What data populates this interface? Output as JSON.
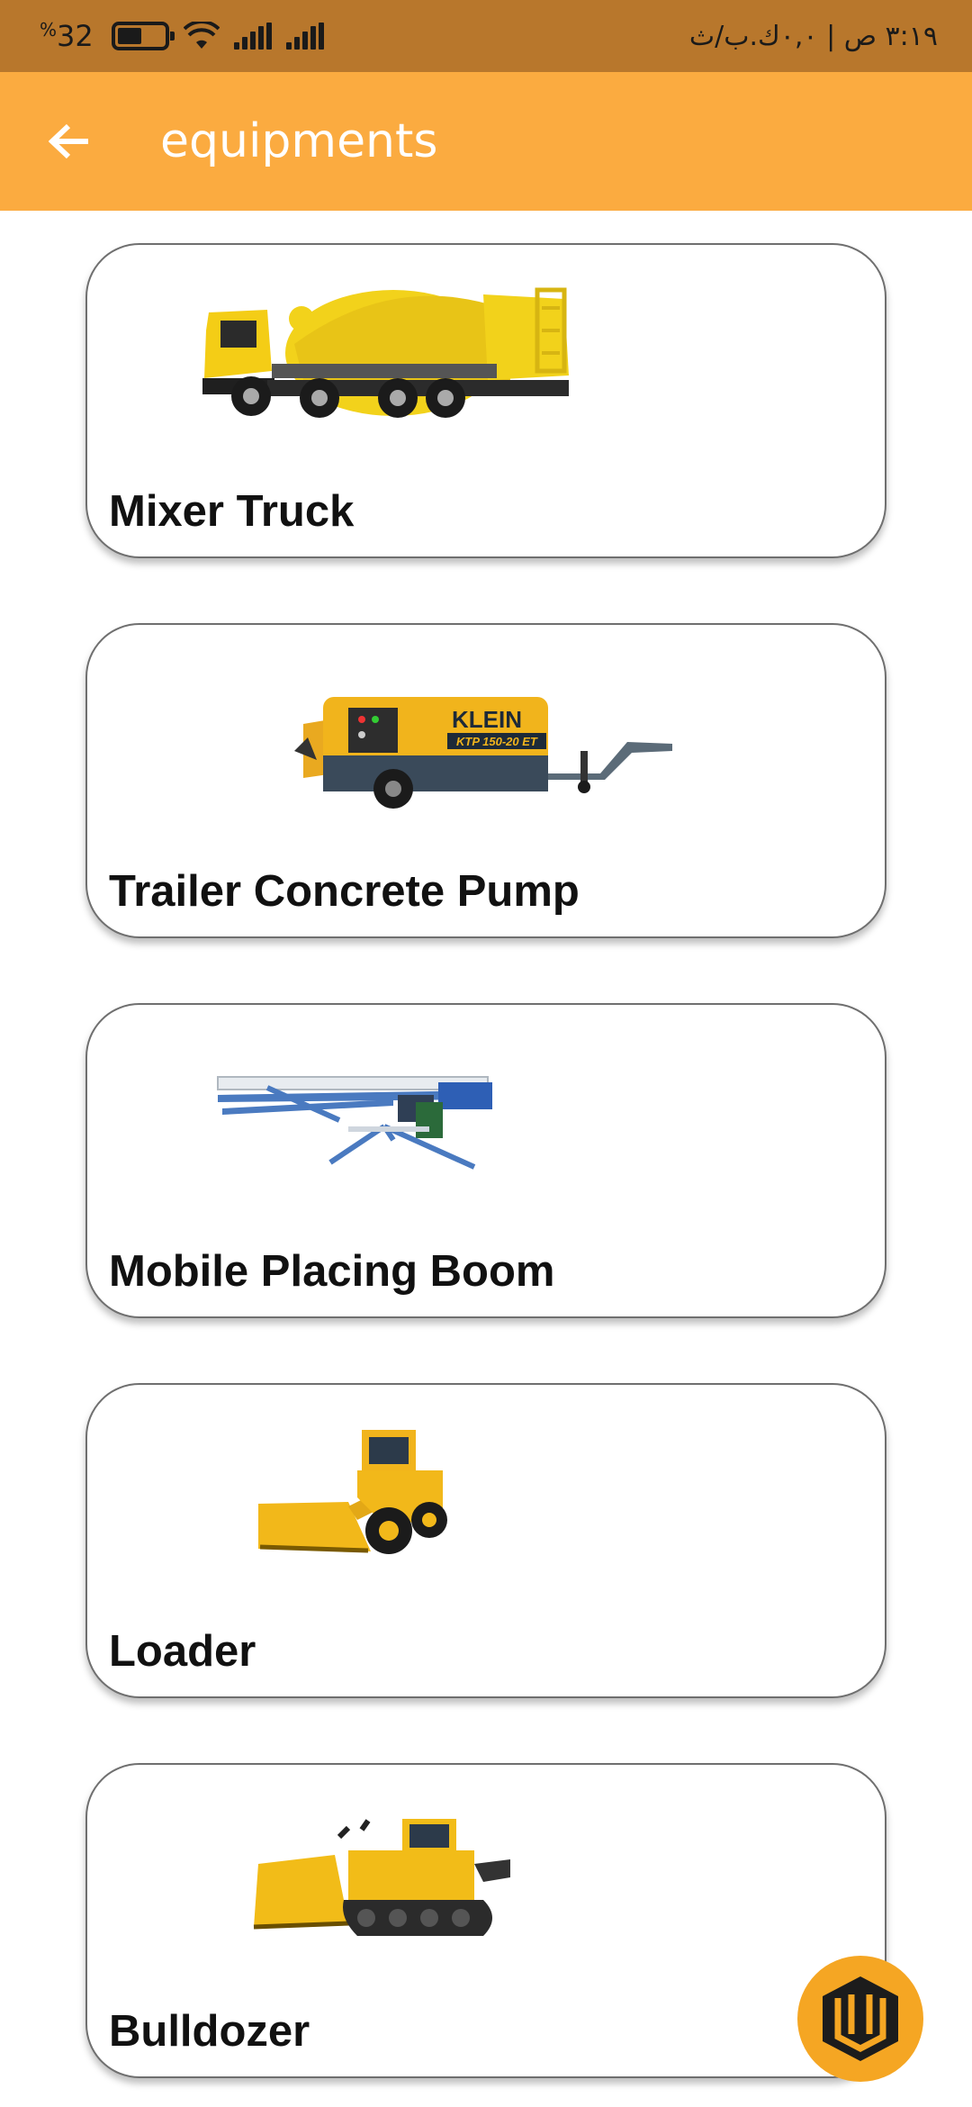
{
  "status_bar": {
    "battery_level": "32",
    "battery_pct_sign": "%",
    "right_text": "٣:١٩ ص | ٠,٠ك.ب/ث",
    "icons": [
      "battery-icon",
      "wifi-icon",
      "signal-icon",
      "signal-icon"
    ]
  },
  "app_bar": {
    "title": "equipments",
    "back_icon": "arrow-left-icon",
    "background": "#fbab40"
  },
  "equipment": [
    {
      "label": "Mixer Truck",
      "image": "mixer-truck-image"
    },
    {
      "label": "Trailer Concrete Pump",
      "image": "trailer-concrete-pump-image"
    },
    {
      "label": "Mobile Placing Boom",
      "image": "mobile-placing-boom-image"
    },
    {
      "label": "Loader",
      "image": "loader-image"
    },
    {
      "label": "Bulldozer",
      "image": "bulldozer-image"
    }
  ],
  "pump_brand": "KLEIN",
  "pump_model": "KTP 150-20 ET",
  "fab": {
    "icon": "app-logo-icon",
    "color": "#f5a623"
  }
}
